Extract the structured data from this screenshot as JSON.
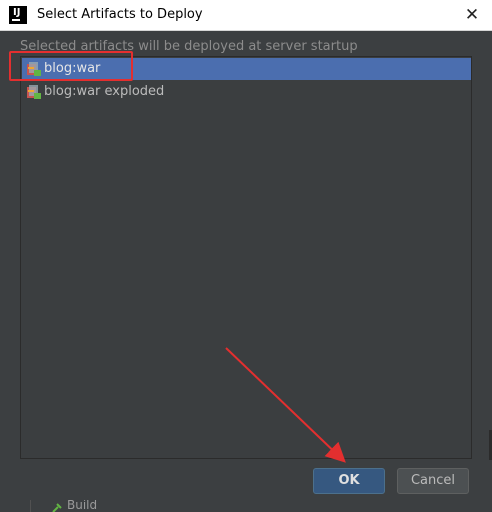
{
  "window": {
    "title": "Select Artifacts to Deploy",
    "logo_text": "IJ",
    "close_glyph": "✕"
  },
  "description": "Selected artifacts will be deployed at server startup",
  "artifacts": [
    {
      "label": "blog:war",
      "selected": true,
      "icon": "war-artifact-icon"
    },
    {
      "label": "blog:war exploded",
      "selected": false,
      "icon": "war-exploded-artifact-icon"
    }
  ],
  "buttons": {
    "ok": "OK",
    "cancel": "Cancel"
  },
  "background": {
    "build_label": "Build"
  },
  "colors": {
    "dialog_bg": "#3c3f41",
    "selection": "#4b6eaf",
    "ok_button": "#365880",
    "annotation": "#e32f2f"
  }
}
